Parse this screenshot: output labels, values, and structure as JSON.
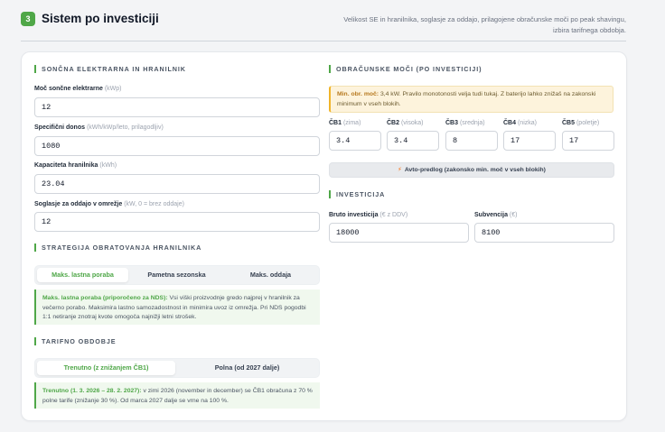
{
  "header": {
    "step": "3",
    "title": "Sistem po investiciji",
    "description": "Velikost SE in hranilnika, soglasje za oddajo, prilagojene obračunske moči po peak shavingu, izbira tarifnega obdobja."
  },
  "solar": {
    "section_title": "SONČNA ELEKTRARNA IN HRANILNIK",
    "fields": [
      {
        "label": "Moč sončne elektrarne",
        "unit": "(kWp)",
        "value": "12"
      },
      {
        "label": "Specifični donos",
        "unit": "(kWh/kWp/leto, prilagodljiv)",
        "value": "1080"
      },
      {
        "label": "Kapaciteta hranilnika",
        "unit": "(kWh)",
        "value": "23.04"
      },
      {
        "label": "Soglasje za oddajo v omrežje",
        "unit": "(kW, 0 = brez oddaje)",
        "value": "12"
      }
    ]
  },
  "strategy": {
    "section_title": "STRATEGIJA OBRATOVANJA HRANILNIKA",
    "options": [
      "Maks. lastna poraba",
      "Pametna sezonska",
      "Maks. oddaja"
    ],
    "selected": 0,
    "info_bold": "Maks. lastna poraba (priporočeno za NDS):",
    "info_text": " Vsi viški proizvodnje gredo najprej v hranilnik za večerno porabo. Maksimira lastno samozadostnost in minimira uvoz iz omrežja. Pri NDS pogodbi 1:1 netiranje znotraj kvote omogoča najnižji letni strošek."
  },
  "tariff": {
    "section_title": "TARIFNO OBDOBJE",
    "options": [
      "Trenutno (z znižanjem ČB1)",
      "Polna (od 2027 dalje)"
    ],
    "selected": 0,
    "info_bold": "Trenutno (1. 3. 2026 – 28. 2. 2027):",
    "info_text": " v zimi 2026 (november in december) se ČB1 obračuna z 70 % polne tarife (znižanje 30 %). Od marca 2027 dalje se vrne na 100 %."
  },
  "powers": {
    "section_title": "OBRAČUNSKE MOČI (PO INVESTICIJI)",
    "warn_bold": "Min. obr. moč:",
    "warn_text": " 3,4 kW. Pravilo monotonosti velja tudi tukaj. Z baterijo lahko znižaš na zakonski minimum v vseh blokih.",
    "blocks": [
      {
        "label": "ČB1",
        "unit": "(zima)",
        "value": "3.4"
      },
      {
        "label": "ČB2",
        "unit": "(visoka)",
        "value": "3.4"
      },
      {
        "label": "ČB3",
        "unit": "(srednja)",
        "value": "8"
      },
      {
        "label": "ČB4",
        "unit": "(nizka)",
        "value": "17"
      },
      {
        "label": "ČB5",
        "unit": "(poletje)",
        "value": "17"
      }
    ],
    "auto_button": "Avto-predlog (zakonsko min. moč v vseh blokih)",
    "auto_icon": "lightning-icon"
  },
  "investment": {
    "section_title": "INVESTICIJA",
    "gross_label": "Bruto investicija",
    "gross_unit": "(€ z DDV)",
    "gross_value": "18000",
    "subsidy_label": "Subvencija",
    "subsidy_unit": "(€)",
    "subsidy_value": "8100"
  },
  "colors": {
    "accent": "#4fa748",
    "warning": "#f0b429"
  }
}
